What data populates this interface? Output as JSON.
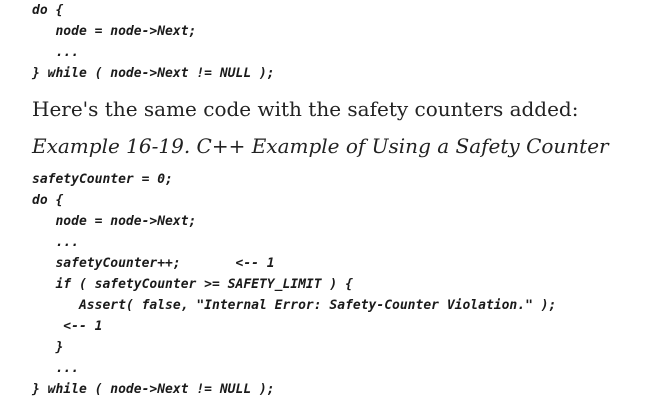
{
  "code_before": {
    "lines": [
      "do {",
      "   node = node->Next;",
      "   ...",
      "} while ( node->Next != NULL );"
    ]
  },
  "prose": {
    "text": "Here's the same code with the safety counters added:"
  },
  "caption": {
    "text": "Example 16-19. C++ Example of Using a Safety Counter"
  },
  "code_after": {
    "lines": [
      "safetyCounter = 0;",
      "do {",
      "   node = node->Next;",
      "   ...",
      "   safetyCounter++;       <-- 1",
      "   if ( safetyCounter >= SAFETY_LIMIT ) {",
      "      Assert( false, \"Internal Error: Safety-Counter Violation.\" );",
      "    <-- 1",
      "   }",
      "   ...",
      "} while ( node->Next != NULL );"
    ]
  }
}
